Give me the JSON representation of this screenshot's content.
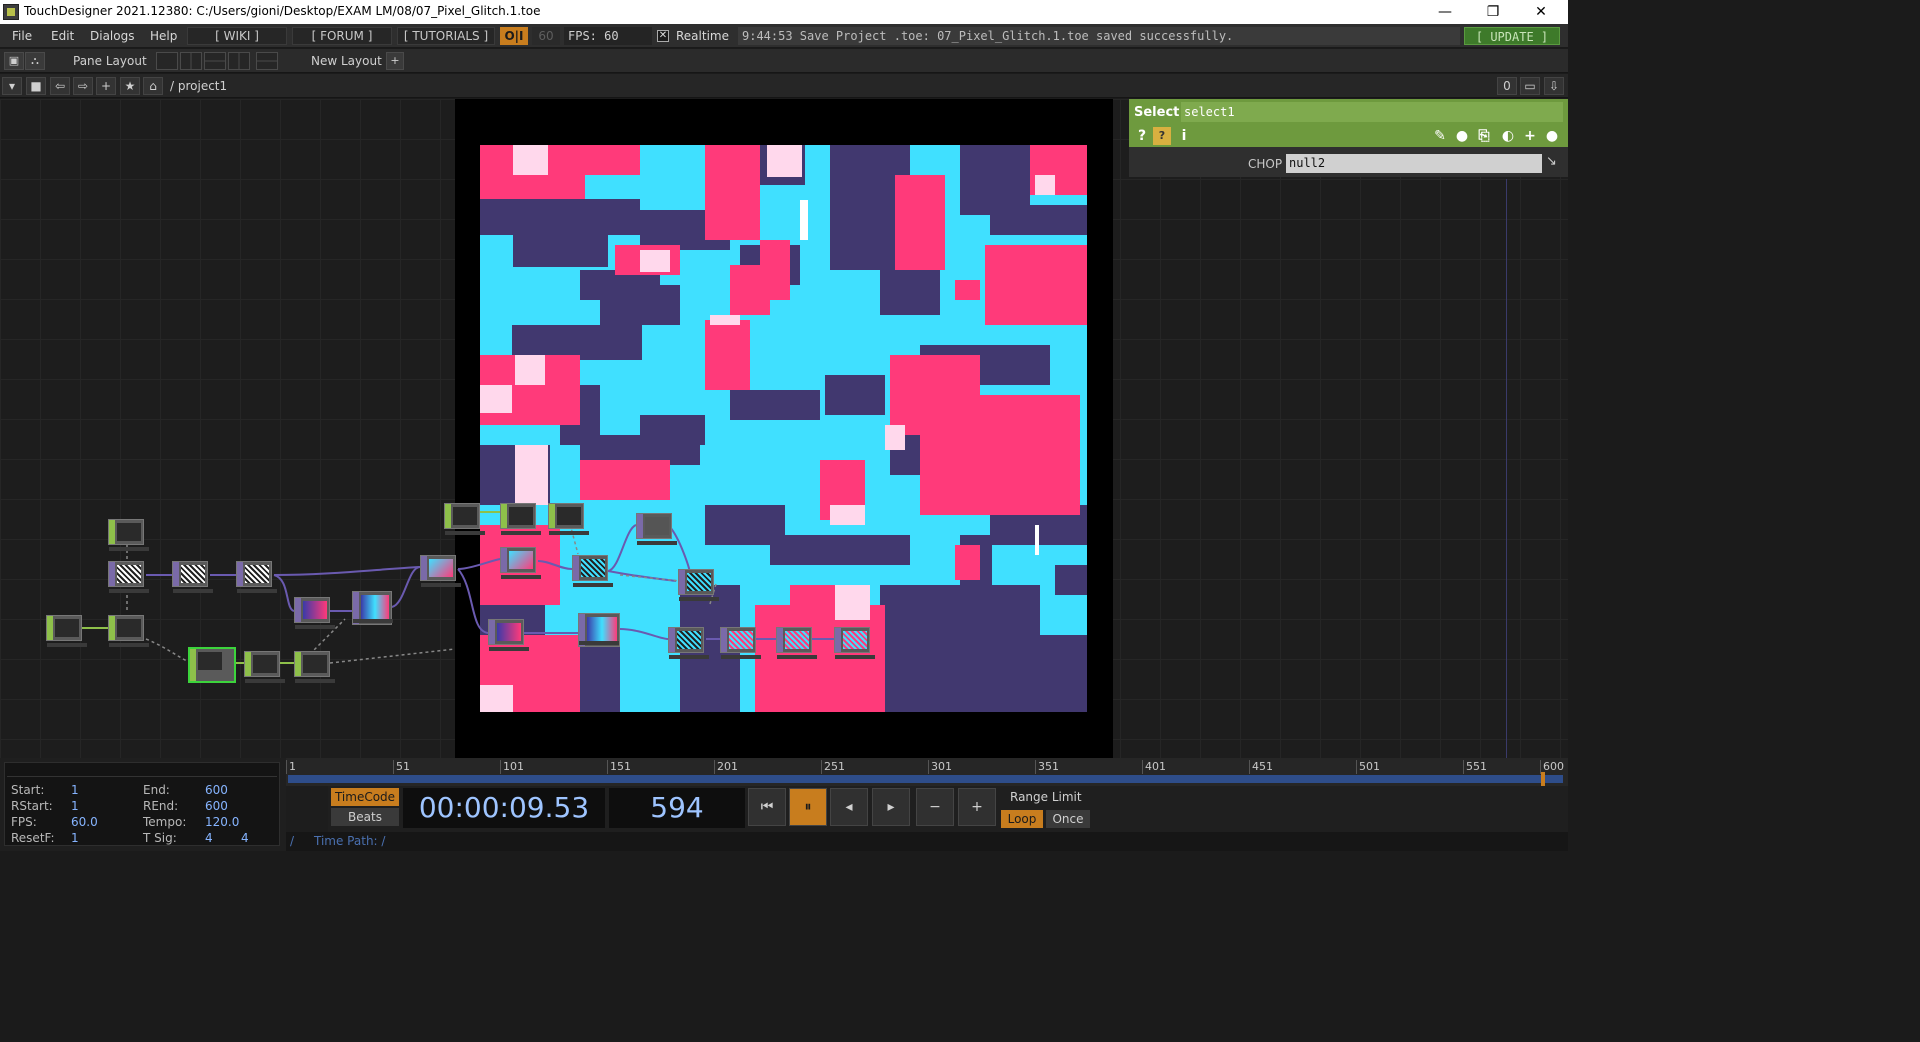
{
  "window": {
    "title": "TouchDesigner 2021.12380: C:/Users/gioni/Desktop/EXAM LM/08/07_Pixel_Glitch.1.toe",
    "minimize": "—",
    "maximize": "❐",
    "close": "✕"
  },
  "menu": {
    "items": [
      "File",
      "Edit",
      "Dialogs",
      "Help"
    ],
    "wiki": "[ WIKI ]",
    "forum": "[ FORUM ]",
    "tutorials": "[ TUTORIALS ]",
    "oi": "O|I",
    "sixty": "60",
    "fps": "FPS: 60",
    "realtime_label": "Realtime",
    "status": "9:44:53 Save Project .toe: 07_Pixel_Glitch.1.toe saved successfully.",
    "update": "[ UPDATE ]"
  },
  "panebar": {
    "pane_layout": "Pane Layout",
    "new_layout": "New Layout",
    "plus": "+"
  },
  "pathbar": {
    "path": "/ project1",
    "counter": "0"
  },
  "params": {
    "optype": "Select",
    "opname": "select1",
    "chop_label": "CHOP",
    "chop_value": "null2"
  },
  "timeline": {
    "ticks": [
      "1",
      "51",
      "101",
      "151",
      "201",
      "251",
      "301",
      "351",
      "401",
      "451",
      "501",
      "551",
      "600"
    ],
    "range": {
      "start_label": "Start:",
      "start": "1",
      "end_label": "End:",
      "end": "600",
      "rstart_label": "RStart:",
      "rstart": "1",
      "rend_label": "REnd:",
      "rend": "600",
      "fps_label": "FPS:",
      "fps": "60.0",
      "tempo_label": "Tempo:",
      "tempo": "120.0",
      "resetf_label": "ResetF:",
      "resetf": "1",
      "tsig_label": "T Sig:",
      "tsig_a": "4",
      "tsig_b": "4"
    },
    "timecode_btn": "TimeCode",
    "beats_btn": "Beats",
    "timecode": "00:00:09.53",
    "frame": "594",
    "range_limit": "Range Limit",
    "loop": "Loop",
    "once": "Once",
    "time_path": "Time Path: /"
  },
  "colors": {
    "accent_orange": "#c87d1e",
    "select_green": "#6e9a3e",
    "glitch_cyan": "#40e0ff",
    "glitch_pink": "#ff3a7a",
    "glitch_navy": "#41386f",
    "glitch_pale": "#ffd8ec"
  }
}
